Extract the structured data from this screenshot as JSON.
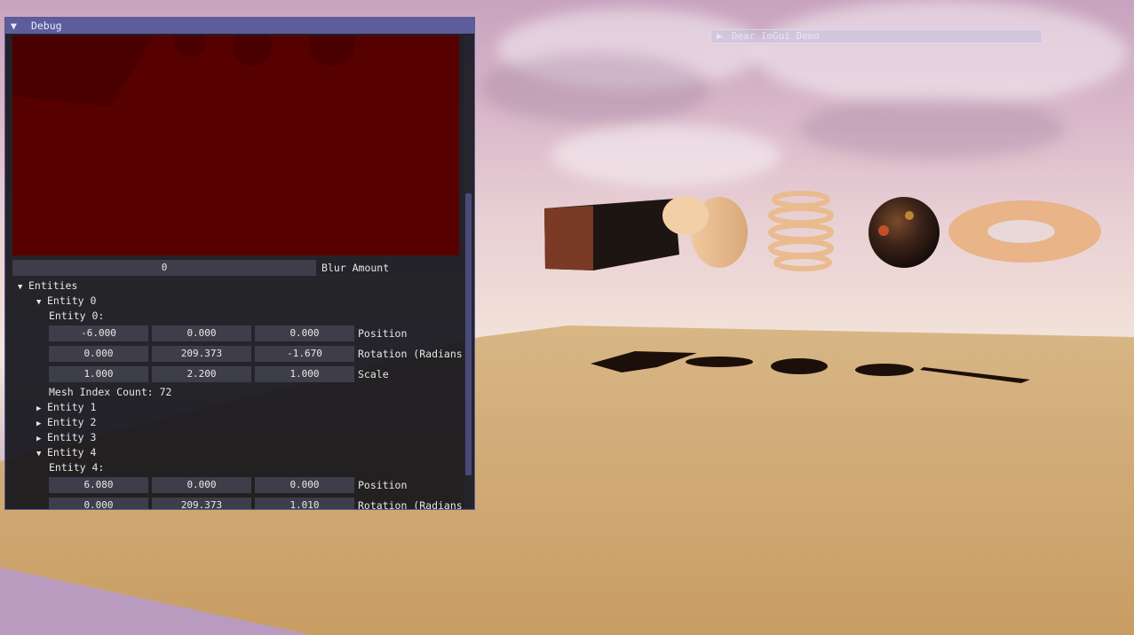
{
  "demo_window": {
    "title": "Dear ImGui Demo",
    "collapsed_icon": "▶"
  },
  "debug_window": {
    "title": "Debug",
    "collapse_icon": "▼",
    "blur": {
      "value": "0",
      "label": "Blur Amount"
    },
    "entities_header": "Entities",
    "entities_icon": "▼",
    "entity0": {
      "header": "Entity 0",
      "icon": "▼",
      "subtitle": "Entity 0:",
      "position": {
        "x": "-6.000",
        "y": "0.000",
        "z": "0.000",
        "label": "Position"
      },
      "rotation": {
        "x": "0.000",
        "y": "209.373",
        "z": "-1.670",
        "label": "Rotation (Radians"
      },
      "scale": {
        "x": "1.000",
        "y": "2.200",
        "z": "1.000",
        "label": "Scale"
      },
      "mesh_info": "Mesh Index Count: 72"
    },
    "collapsed_entities": [
      {
        "label": "Entity 1",
        "icon": "▶"
      },
      {
        "label": "Entity 2",
        "icon": "▶"
      },
      {
        "label": "Entity 3",
        "icon": "▶"
      }
    ],
    "entity4": {
      "header": "Entity 4",
      "icon": "▼",
      "subtitle": "Entity 4:",
      "position": {
        "x": "6.080",
        "y": "0.000",
        "z": "0.000",
        "label": "Position"
      },
      "rotation": {
        "x": "0.000",
        "y": "209.373",
        "z": "1.010",
        "label": "Rotation (Radians"
      }
    }
  },
  "colors": {
    "title_bar": "#5d5d9c",
    "field_bg": "#3e3e4a",
    "preview_bg": "#550000"
  }
}
